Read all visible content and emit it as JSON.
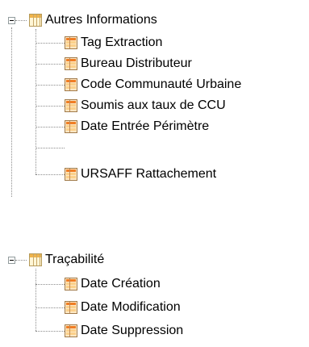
{
  "tree": {
    "groups": [
      {
        "label": "Autres Informations",
        "icon": "table-icon",
        "children": [
          {
            "label": "Tag Extraction",
            "icon": "field-icon"
          },
          {
            "label": "Bureau Distributeur",
            "icon": "field-icon"
          },
          {
            "label": "Code Communauté Urbaine",
            "icon": "field-icon"
          },
          {
            "label": "Soumis aux taux de CCU",
            "icon": "field-icon"
          },
          {
            "label": "Date Entrée Périmètre",
            "icon": "field-icon"
          },
          {
            "label": "URSAFF Rattachement",
            "icon": "field-icon"
          }
        ]
      },
      {
        "label": "Traçabilité",
        "icon": "table-icon",
        "children": [
          {
            "label": "Date Création",
            "icon": "field-icon"
          },
          {
            "label": "Date Modification",
            "icon": "field-icon"
          },
          {
            "label": "Date Suppression",
            "icon": "field-icon"
          }
        ]
      }
    ]
  }
}
